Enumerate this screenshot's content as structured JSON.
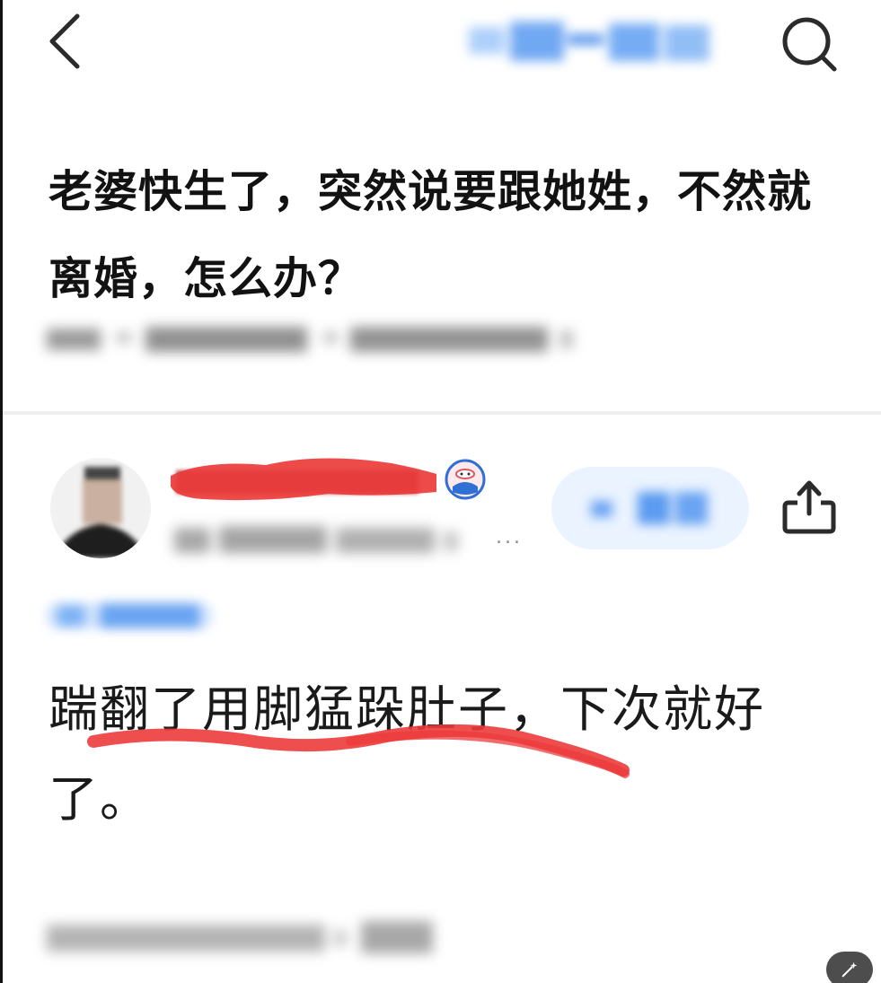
{
  "question": {
    "title": "老婆快生了，突然说要跟她姓，不然就离婚，怎么办？"
  },
  "answer": {
    "more_label": "...",
    "text": "踹翻了用脚猛跺肚子，下次就好了。"
  },
  "colors": {
    "title_text": "#121212",
    "answer_text": "#1a1a1a",
    "blur_blue": "#5b9bf0",
    "follow_bg": "#eaf3ff",
    "scribble_red": "#ec3b3b",
    "divider": "#eeeeee"
  },
  "icons": {
    "back": "chevron-left-icon",
    "search": "search-icon",
    "share": "share-icon",
    "badge": "badge-icon",
    "corner": "magic-wand-icon"
  }
}
